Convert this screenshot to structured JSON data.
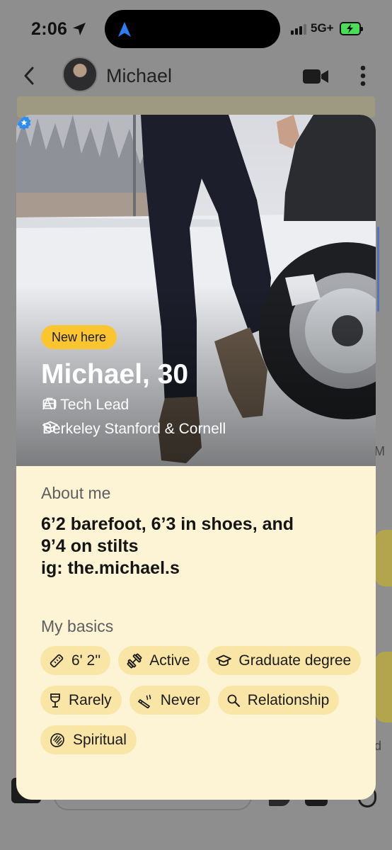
{
  "status_bar": {
    "time": "2:06",
    "network": "5G+"
  },
  "chat_header": {
    "name": "Michael"
  },
  "card": {
    "badge": "New here",
    "name_age": "Michael, 30",
    "job": "AI Tech Lead",
    "education": "Berkeley Stanford & Cornell",
    "about_label": "About me",
    "bio": "6’2 barefoot, 6’3 in shoes, and\n9’4 on stilts\nig: the.michael.s",
    "basics_label": "My basics",
    "basics": [
      {
        "icon": "ruler-icon",
        "label": "6' 2''"
      },
      {
        "icon": "dumbbell-icon",
        "label": "Active"
      },
      {
        "icon": "graduation-cap-icon",
        "label": "Graduate degree"
      },
      {
        "icon": "wine-glass-icon",
        "label": "Rarely"
      },
      {
        "icon": "cigarette-icon",
        "label": "Never"
      },
      {
        "icon": "magnifier-icon",
        "label": "Relationship"
      },
      {
        "icon": "praying-hands-icon",
        "label": "Spiritual"
      }
    ]
  },
  "background": {
    "right_edge_text_1": "M",
    "right_edge_text_2": "d"
  },
  "colors": {
    "badge": "#fbc52f",
    "card_bg": "#fdf4d6",
    "chip_bg": "#f9e6a6",
    "verified": "#2d8cf0",
    "dim_overlay": "#8e8e8e"
  }
}
